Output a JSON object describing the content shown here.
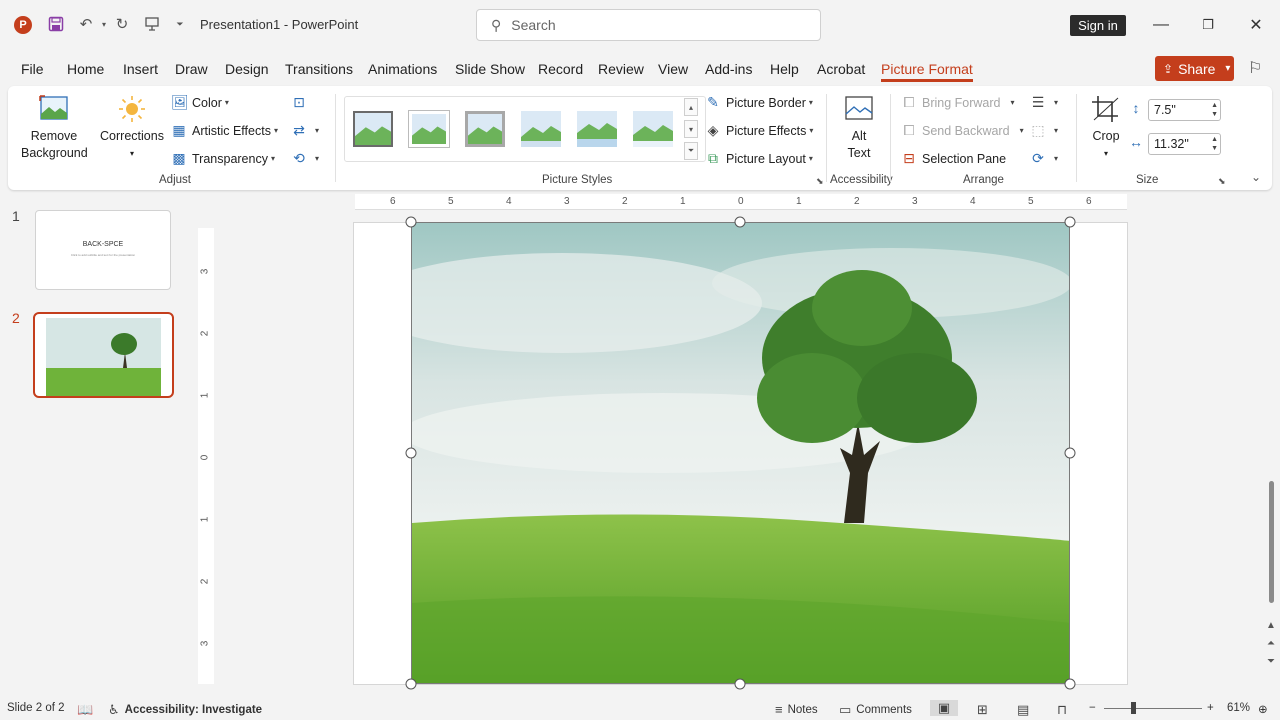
{
  "titlebar": {
    "doc_title": "Presentation1  -  PowerPoint",
    "search_placeholder": "Search",
    "sign_in": "Sign in"
  },
  "tabs": [
    "File",
    "Home",
    "Insert",
    "Draw",
    "Design",
    "Transitions",
    "Animations",
    "Slide Show",
    "Record",
    "Review",
    "View",
    "Add-ins",
    "Help",
    "Acrobat",
    "Picture Format"
  ],
  "active_tab": "Picture Format",
  "share_label": "Share",
  "ribbon": {
    "adjust": {
      "remove_background": "Remove Background",
      "corrections": "Corrections",
      "color": "Color",
      "artistic_effects": "Artistic Effects",
      "transparency": "Transparency",
      "label": "Adjust"
    },
    "picture_styles": {
      "picture_border": "Picture Border",
      "picture_effects": "Picture Effects",
      "picture_layout": "Picture Layout",
      "label": "Picture Styles"
    },
    "accessibility": {
      "alt_text_1": "Alt",
      "alt_text_2": "Text",
      "label": "Accessibility"
    },
    "arrange": {
      "bring_forward": "Bring Forward",
      "send_backward": "Send Backward",
      "selection_pane": "Selection Pane",
      "label": "Arrange"
    },
    "size": {
      "crop": "Crop",
      "height": "7.5\"",
      "width": "11.32\"",
      "label": "Size"
    }
  },
  "slides": [
    {
      "number": "1",
      "title": "BACK-SPCE",
      "subtitle": "Click to add subtitle and text for the presentation"
    },
    {
      "number": "2"
    }
  ],
  "ruler": {
    "horizontal": [
      "6",
      "5",
      "4",
      "3",
      "2",
      "1",
      "0",
      "1",
      "2",
      "3",
      "4",
      "5",
      "6"
    ],
    "vertical": [
      "3",
      "2",
      "1",
      "0",
      "1",
      "2",
      "3"
    ]
  },
  "status": {
    "slide_info": "Slide 2 of 2",
    "accessibility": "Accessibility: Investigate",
    "notes": "Notes",
    "comments": "Comments",
    "zoom": "61%"
  },
  "colors": {
    "accent": "#c43e1c",
    "ribbon_icon": "#2f6fb6"
  }
}
